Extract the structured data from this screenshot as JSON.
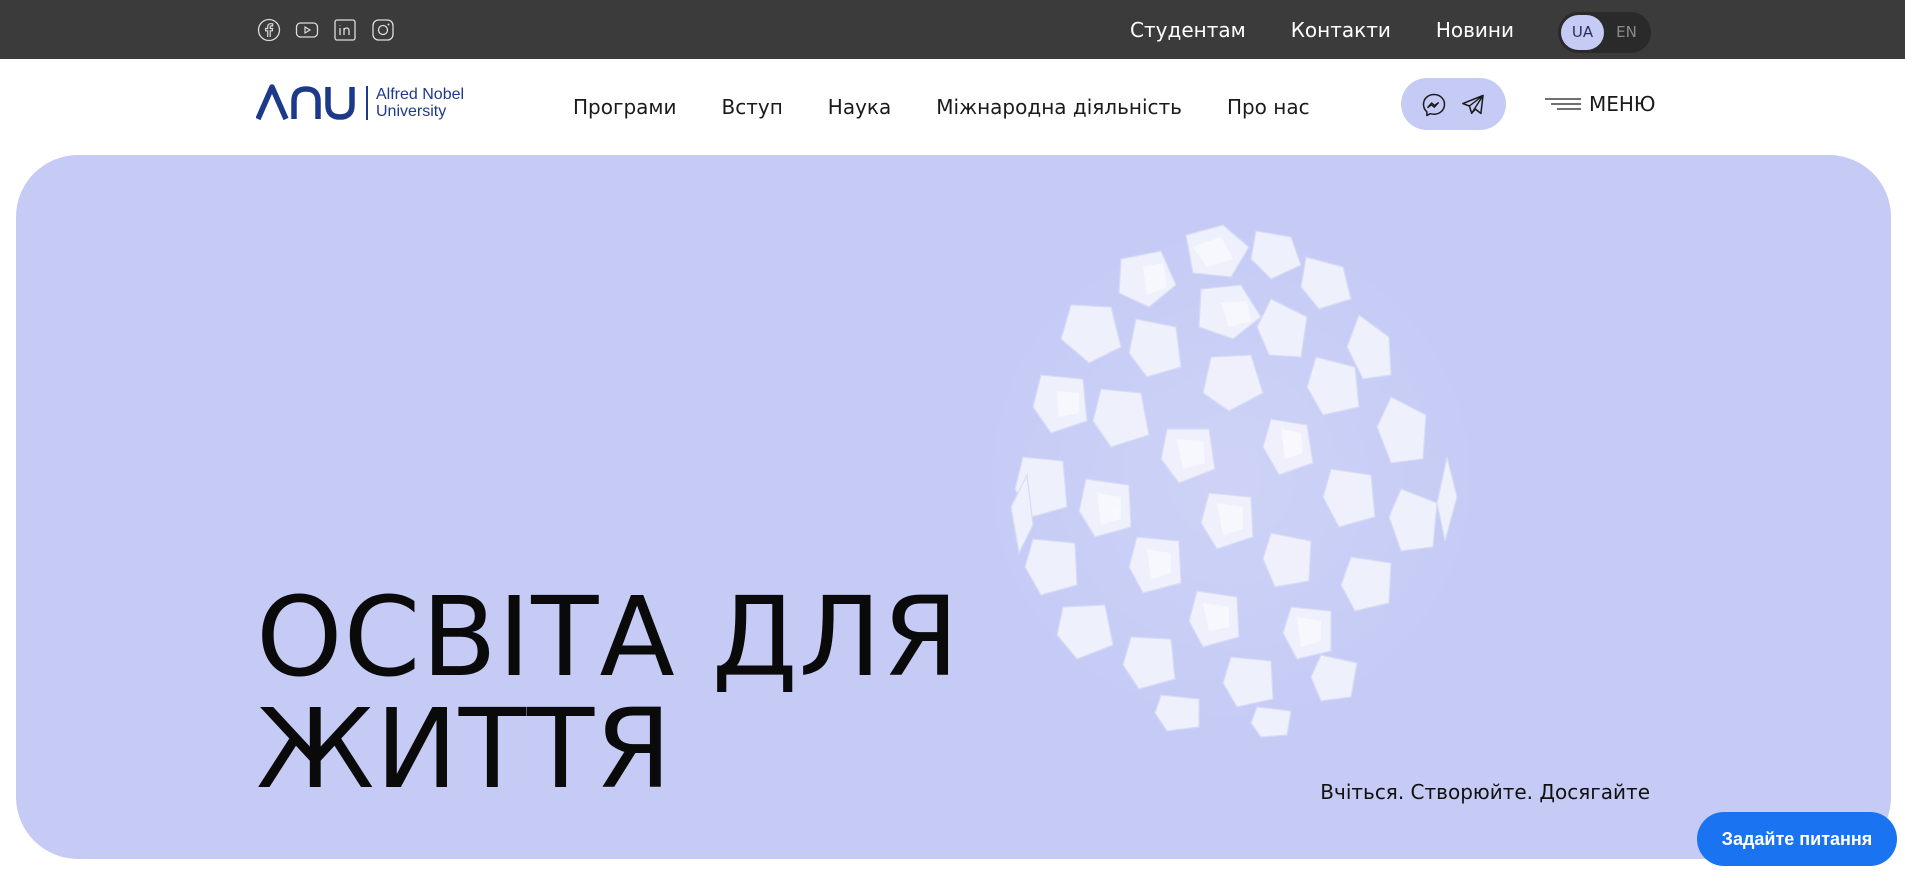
{
  "topbar": {
    "socials": [
      {
        "icon": "facebook-icon"
      },
      {
        "icon": "youtube-icon"
      },
      {
        "icon": "linkedin-icon"
      },
      {
        "icon": "instagram-icon"
      }
    ],
    "links": [
      "Студентам",
      "Контакти",
      "Новини"
    ],
    "languages": {
      "active": "UA",
      "inactive": "EN"
    }
  },
  "header": {
    "logo": {
      "mark": "ANU",
      "line1": "Alfred Nobel",
      "line2": "University"
    },
    "nav": [
      "Програми",
      "Вступ",
      "Наука",
      "Міжнародна діяльність",
      "Про нас"
    ],
    "messengers": [
      {
        "icon": "messenger-icon"
      },
      {
        "icon": "telegram-icon"
      }
    ],
    "menu_label": "МЕНЮ"
  },
  "hero": {
    "title_line1": "ОСВІТА ДЛЯ",
    "title_line2": "ЖИТТЯ",
    "tagline": "Вчіться. Створюйте. Досягайте"
  },
  "ask_button": "Задайте питання",
  "colors": {
    "topbar_bg": "#3b3b3b",
    "accent_lavender": "#c5cbf5",
    "brand_blue": "#1d3a8a",
    "cta_blue": "#1a73f0"
  }
}
